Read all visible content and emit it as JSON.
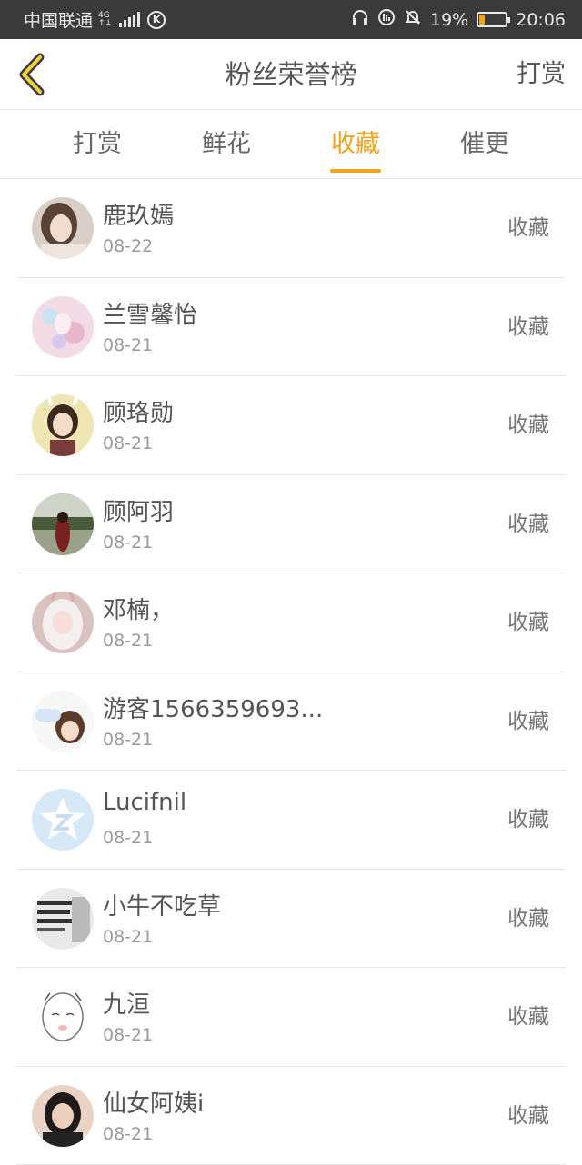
{
  "status_bar": {
    "carrier": "中国联通",
    "network_top": "4G",
    "network_bottom": "↑↓",
    "k_icon_label": "K",
    "battery_percent": "19%",
    "battery_level": 0.19,
    "time": "20:06"
  },
  "header": {
    "title": "粉丝荣誉榜",
    "action_label": "打赏"
  },
  "tabs": [
    {
      "label": "打赏",
      "active": false
    },
    {
      "label": "鲜花",
      "active": false
    },
    {
      "label": "收藏",
      "active": true
    },
    {
      "label": "催更",
      "active": false
    }
  ],
  "accent_color": "#f0a31c",
  "fans": [
    {
      "name": "鹿玖嫣",
      "date": "08-22",
      "action": "收藏",
      "avatar": "girl-photo-avatar"
    },
    {
      "name": "兰雪馨怡",
      "date": "08-21",
      "action": "收藏",
      "avatar": "pastel-anime-avatar"
    },
    {
      "name": "顾珞勋",
      "date": "08-21",
      "action": "收藏",
      "avatar": "anime-girl-avatar"
    },
    {
      "name": "顾阿羽",
      "date": "08-21",
      "action": "收藏",
      "avatar": "outdoor-photo-avatar"
    },
    {
      "name": "邓楠，",
      "date": "08-21",
      "action": "收藏",
      "avatar": "anime-white-hair-avatar"
    },
    {
      "name": "游客1566359693...",
      "date": "08-21",
      "action": "收藏",
      "avatar": "cartoon-sticker-avatar"
    },
    {
      "name": "Lucifnil",
      "date": "08-21",
      "action": "收藏",
      "avatar": "default-star-avatar"
    },
    {
      "name": "小牛不吃草",
      "date": "08-21",
      "action": "收藏",
      "avatar": "text-image-avatar"
    },
    {
      "name": "九洹",
      "date": "08-21",
      "action": "收藏",
      "avatar": "sketch-anime-avatar"
    },
    {
      "name": "仙女阿姨i",
      "date": "08-21",
      "action": "收藏",
      "avatar": "girl-dark-hair-avatar"
    }
  ]
}
